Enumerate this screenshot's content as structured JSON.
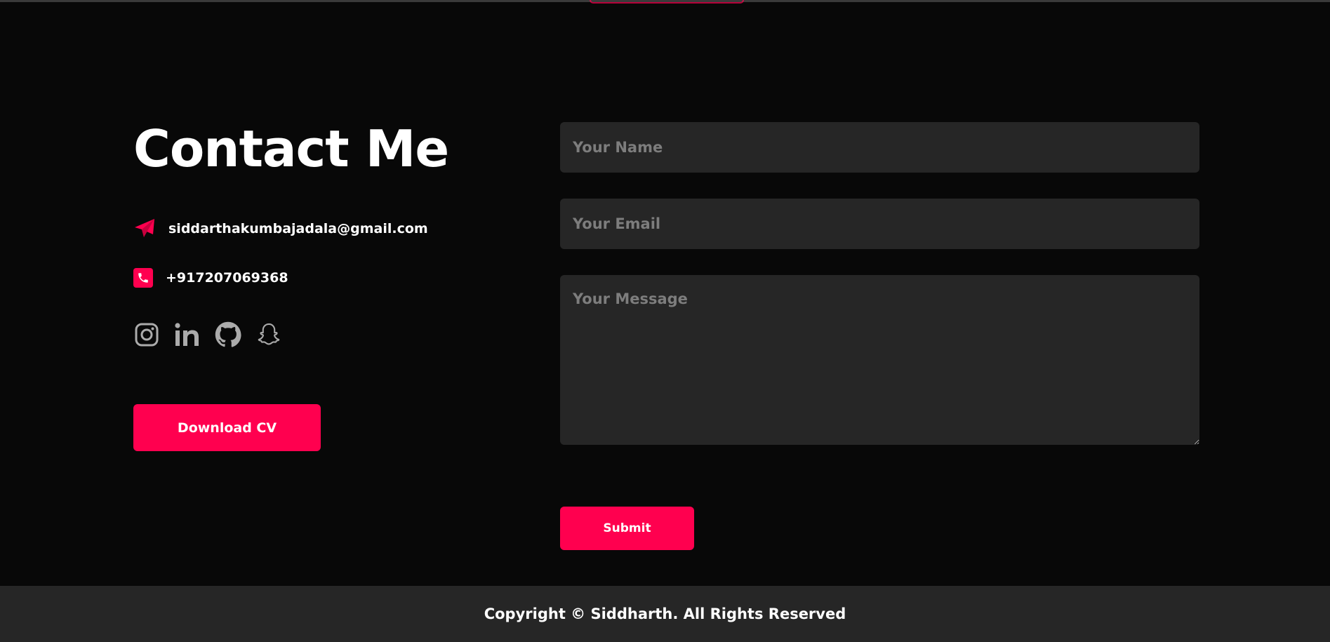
{
  "contact": {
    "title": "Contact Me",
    "email": "siddarthakumbajadala@gmail.com",
    "phone": "+917207069368",
    "download_label": "Download CV",
    "social": [
      "instagram-icon",
      "linkedin-icon",
      "github-icon",
      "snapchat-icon"
    ]
  },
  "form": {
    "name_placeholder": "Your Name",
    "email_placeholder": "Your Email",
    "message_placeholder": "Your Message",
    "submit_label": "Submit"
  },
  "footer": {
    "copyright": "Copyright © Siddharth. All Rights Reserved"
  },
  "colors": {
    "accent": "#ff004f",
    "background": "#080808",
    "field_bg": "#262626",
    "icon_gray": "#ababab"
  }
}
